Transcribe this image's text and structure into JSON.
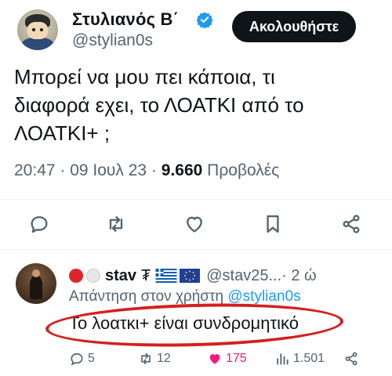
{
  "tweet": {
    "author_name": "Στυλιανός Β΄",
    "author_handle": "@stylian0s",
    "follow_label": "Ακολουθήστε",
    "text_line1": "Μπορεί να μου πει κάποια, τι",
    "text_line2": "διαφορά εχει, το ΛΟΑΤΚΙ από το",
    "text_line3": "ΛΟΑΤΚΙ+ ;",
    "time": "20:47 · 09 Ιουλ 23 · ",
    "views_count": "9.660",
    "views_label": " Προβολές",
    "verified_color": "#1d9bf0"
  },
  "actions": {
    "icons": [
      "reply-icon",
      "retweet-icon",
      "like-icon",
      "bookmark-icon",
      "share-icon"
    ]
  },
  "reply": {
    "name": "stav",
    "name_symbol": "₮",
    "handle": "@stav25...",
    "time": " · 2 ώ",
    "reply_to_label": "Απάντηση στον χρήστη ",
    "reply_to_mention": "@stylian0s",
    "text": "Το λοατκι+ είναι συνδρομητικό",
    "reply_count": "5",
    "retweet_count": "12",
    "like_count": "175",
    "views_count": "1.501",
    "highlight_color": "#d4201f",
    "like_color": "#f91880"
  }
}
